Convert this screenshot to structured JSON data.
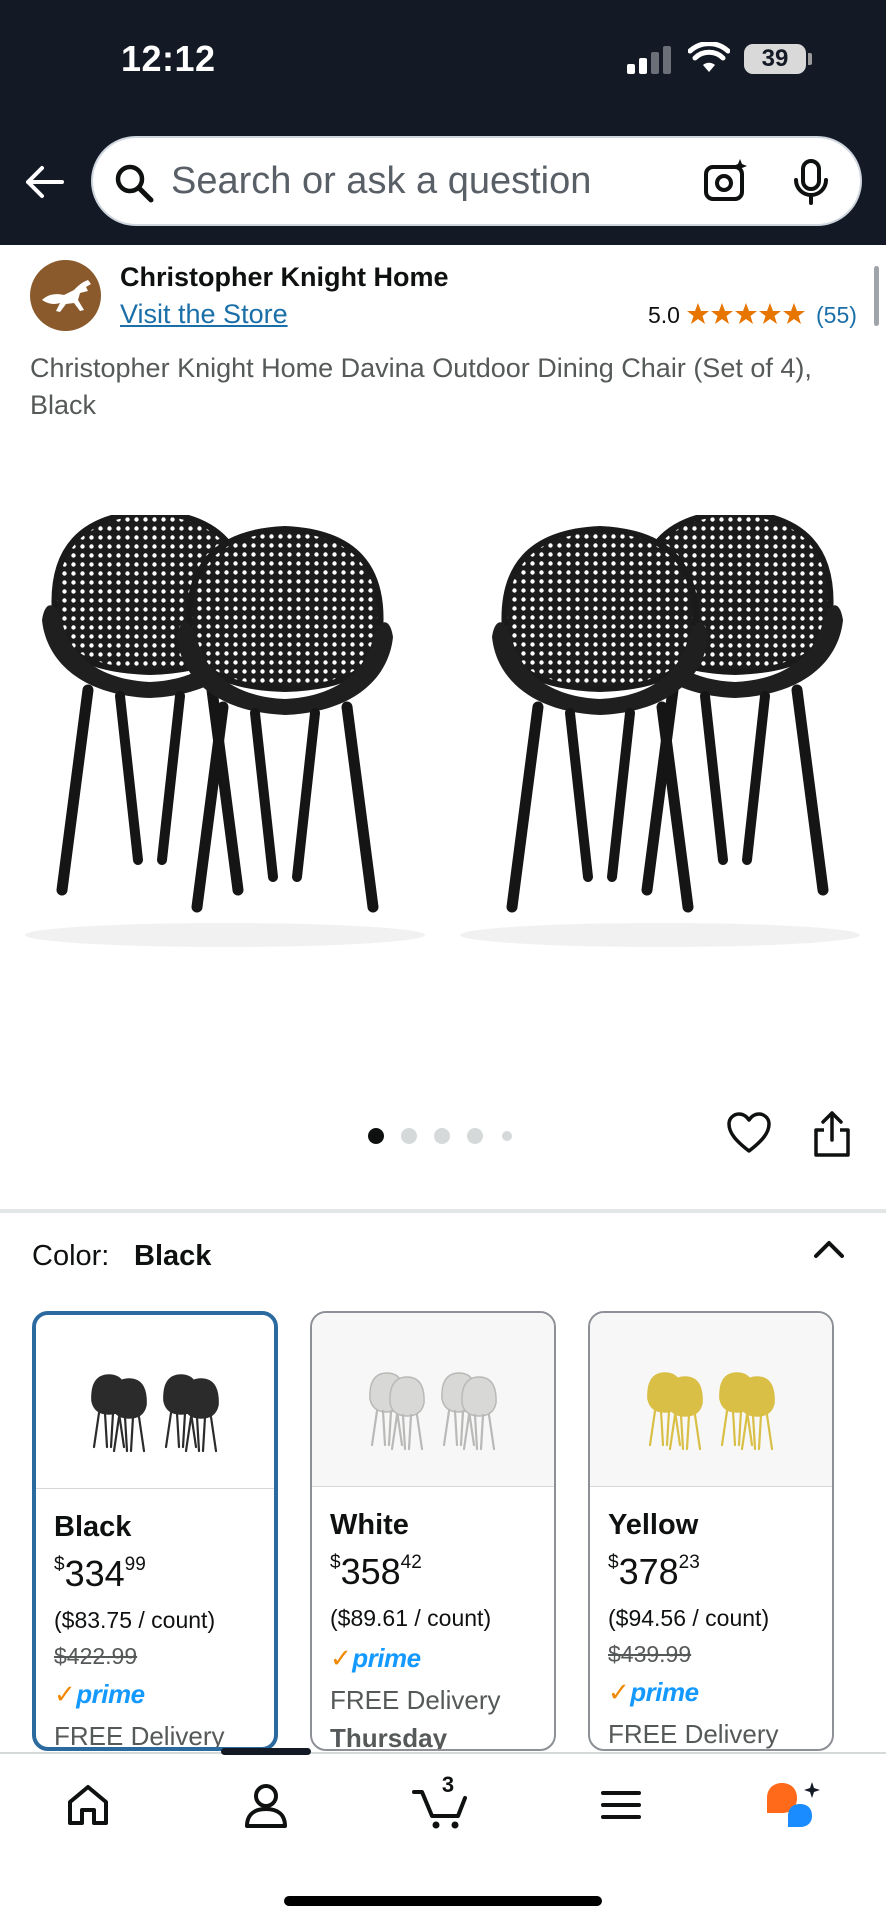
{
  "status_bar": {
    "time": "12:12",
    "battery": "39"
  },
  "search": {
    "placeholder": "Search or ask a question"
  },
  "store": {
    "name": "Christopher Knight Home",
    "visit_label": "Visit the Store",
    "rating": "5.0",
    "stars": 5,
    "review_count": "(55)"
  },
  "product": {
    "title": "Christopher Knight Home Davina Outdoor Dining Chair (Set of 4), Black",
    "image_count": 5,
    "current_image": 1
  },
  "color": {
    "label": "Color:",
    "selected": "Black",
    "options": [
      {
        "name": "Black",
        "price_symbol": "$",
        "price_whole": "334",
        "price_fraction": "99",
        "unit_price": "($83.75 / count)",
        "list_price": "$422.99",
        "prime": "prime",
        "delivery": "FREE Delivery",
        "chair_color": "#2b2b2b",
        "selected": true
      },
      {
        "name": "White",
        "price_symbol": "$",
        "price_whole": "358",
        "price_fraction": "42",
        "unit_price": "($89.61 / count)",
        "list_price": "",
        "prime": "prime",
        "delivery": "FREE Delivery",
        "delivery_day": "Thursday",
        "chair_color": "#d8d8d6",
        "selected": false
      },
      {
        "name": "Yellow",
        "price_symbol": "$",
        "price_whole": "378",
        "price_fraction": "23",
        "unit_price": "($94.56 / count)",
        "list_price": "$439.99",
        "prime": "prime",
        "delivery": "FREE Delivery",
        "chair_color": "#d9bf45",
        "selected": false
      }
    ]
  },
  "bottom_nav": {
    "items": [
      "home-icon",
      "account-icon",
      "cart-icon",
      "menu-icon",
      "rufus-icon"
    ],
    "cart_count": "3"
  },
  "colors": {
    "header_bg": "#131a26",
    "link": "#1a6fa8",
    "star": "#e77600",
    "prime_blue": "#1399ff",
    "prime_check": "#f08804",
    "selected_border": "#2a6a9e"
  }
}
